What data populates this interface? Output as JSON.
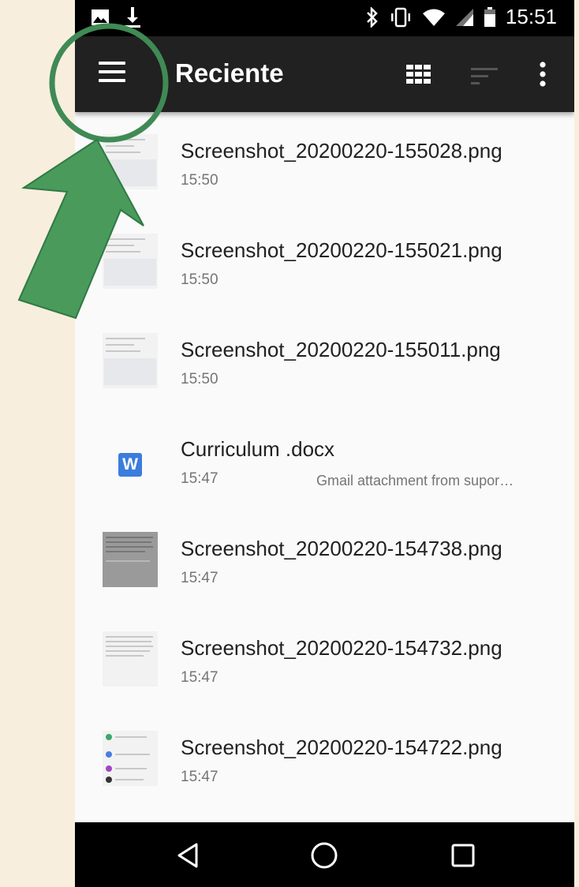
{
  "status_bar": {
    "time": "15:51",
    "left_icons": [
      "image-icon",
      "download-icon"
    ],
    "right_icons": [
      "bluetooth-icon",
      "vibrate-icon",
      "wifi-icon",
      "signal-icon",
      "battery-icon"
    ]
  },
  "app_bar": {
    "title": "Reciente",
    "actions": [
      "menu-icon",
      "grid-view-icon",
      "sort-icon",
      "more-vert-icon"
    ]
  },
  "files": [
    {
      "name": "Screenshot_20200220-155028.png",
      "time": "15:50",
      "summary": "",
      "thumb": "keyboard-screenshot"
    },
    {
      "name": "Screenshot_20200220-155021.png",
      "time": "15:50",
      "summary": "",
      "thumb": "keyboard-screenshot"
    },
    {
      "name": "Screenshot_20200220-155011.png",
      "time": "15:50",
      "summary": "",
      "thumb": "keyboard-screenshot"
    },
    {
      "name": "Curriculum .docx",
      "time": "15:47",
      "summary": "Gmail attachment from supor…",
      "thumb": "word-icon",
      "icon_letter": "W"
    },
    {
      "name": "Screenshot_20200220-154738.png",
      "time": "15:47",
      "summary": "",
      "thumb": "dialog-screenshot"
    },
    {
      "name": "Screenshot_20200220-154732.png",
      "time": "15:47",
      "summary": "",
      "thumb": "text-screenshot"
    },
    {
      "name": "Screenshot_20200220-154722.png",
      "time": "15:47",
      "summary": "",
      "thumb": "inbox-screenshot"
    }
  ],
  "nav_bar": {
    "buttons": [
      "back-icon",
      "home-icon",
      "recents-icon"
    ]
  },
  "annotation": {
    "circle_color": "#3f8a55",
    "arrow_color": "#4a9a5c"
  },
  "colors": {
    "app_bar": "#212121",
    "status_bar": "#000000",
    "word_icon": "#3b7ddd",
    "background": "#f8eedd"
  }
}
